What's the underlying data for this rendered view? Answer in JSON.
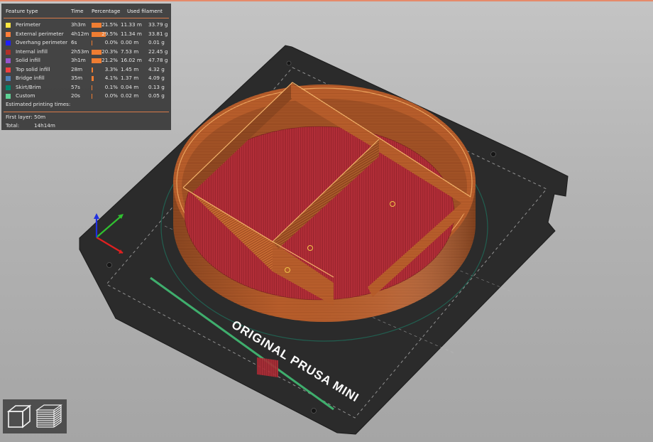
{
  "legend": {
    "headers": {
      "feature": "Feature type",
      "time": "Time",
      "percentage": "Percentage",
      "filament": "Used filament"
    },
    "rows": [
      {
        "label": "Perimeter",
        "time": "3h3m",
        "percent": "21.5%",
        "percent_value": 21.5,
        "length": "11.33 m",
        "weight": "33.79 g",
        "color": "#ffe640"
      },
      {
        "label": "External perimeter",
        "time": "4h12m",
        "percent": "29.5%",
        "percent_value": 29.5,
        "length": "11.34 m",
        "weight": "33.81 g",
        "color": "#ff7d38"
      },
      {
        "label": "Overhang perimeter",
        "time": "6s",
        "percent": "0.0%",
        "percent_value": 0.0,
        "length": "0.00 m",
        "weight": "0.01 g",
        "color": "#1f1fff"
      },
      {
        "label": "Internal infill",
        "time": "2h53m",
        "percent": "20.3%",
        "percent_value": 20.3,
        "length": "7.53 m",
        "weight": "22.45 g",
        "color": "#b03029"
      },
      {
        "label": "Solid infill",
        "time": "3h1m",
        "percent": "21.2%",
        "percent_value": 21.2,
        "length": "16.02 m",
        "weight": "47.78 g",
        "color": "#9654cc"
      },
      {
        "label": "Top solid infill",
        "time": "28m",
        "percent": "3.3%",
        "percent_value": 3.3,
        "length": "1.45 m",
        "weight": "4.32 g",
        "color": "#f04040"
      },
      {
        "label": "Bridge infill",
        "time": "35m",
        "percent": "4.1%",
        "percent_value": 4.1,
        "length": "1.37 m",
        "weight": "4.09 g",
        "color": "#4d80ba"
      },
      {
        "label": "Skirt/Brim",
        "time": "57s",
        "percent": "0.1%",
        "percent_value": 0.1,
        "length": "0.04 m",
        "weight": "0.13 g",
        "color": "#00876e"
      },
      {
        "label": "Custom",
        "time": "20s",
        "percent": "0.0%",
        "percent_value": 0.0,
        "length": "0.02 m",
        "weight": "0.05 g",
        "color": "#5ed194"
      }
    ],
    "estimated_title": "Estimated printing times:",
    "first_layer_label": "First layer:",
    "first_layer_value": "50m",
    "total_label": "Total:",
    "total_value": "14h14m"
  },
  "bed": {
    "logo_text": "ORIGINAL PRUSA MINI"
  },
  "colors": {
    "accent": "#d97a49",
    "bed": "#2b2b2b",
    "wall_orange": "#c8692f",
    "infill_red": "#b5303a",
    "axis_x": "#e02020",
    "axis_y": "#30c030",
    "axis_z": "#2030e0"
  },
  "toolbar": {
    "buttons": [
      {
        "name": "3d-view",
        "icon": "cube-icon"
      },
      {
        "name": "layers-view",
        "icon": "layers-icon"
      }
    ]
  }
}
